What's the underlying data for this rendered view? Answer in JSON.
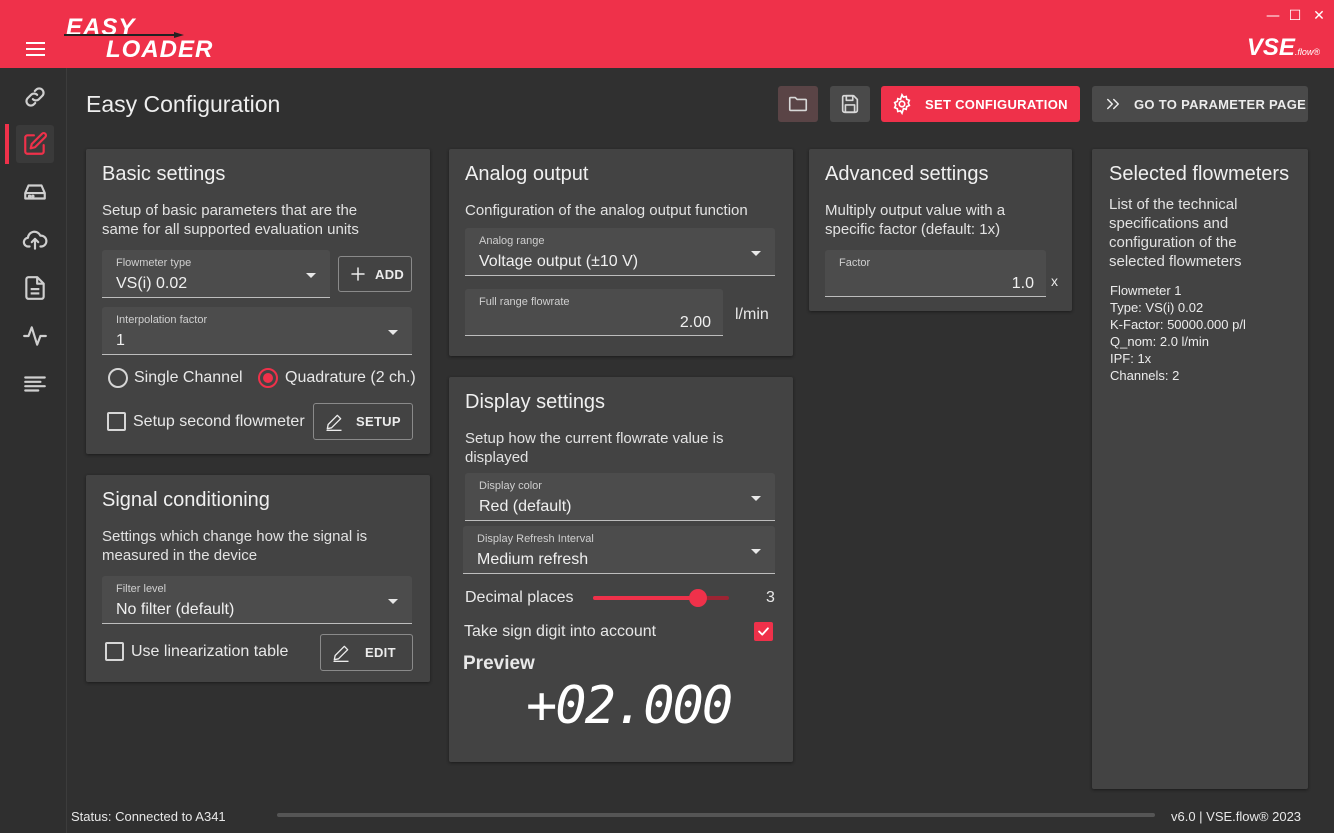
{
  "app": {
    "logo_line1": "EASY",
    "logo_line2": "LOADER",
    "brand": "VSE",
    "brand_sub": ".flow®",
    "window_controls": {
      "minimize": "—",
      "maximize": "☐",
      "close": "✕"
    }
  },
  "sidebar": {
    "items": [
      {
        "icon": "link-icon"
      },
      {
        "icon": "edit-icon",
        "active": true
      },
      {
        "icon": "drive-icon"
      },
      {
        "icon": "cloud-upload-icon"
      },
      {
        "icon": "document-icon"
      },
      {
        "icon": "pulse-icon"
      },
      {
        "icon": "text-lines-icon"
      }
    ]
  },
  "header": {
    "title": "Easy Configuration",
    "set_config_label": "SET CONFIGURATION",
    "goto_param_label": "GO TO PARAMETER PAGE"
  },
  "basic": {
    "title": "Basic settings",
    "desc_line1": "Setup of basic parameters that are the",
    "desc_line2": "same for all supported evaluation units",
    "flowmeter_type_label": "Flowmeter type",
    "flowmeter_type_value": "VS(i) 0.02",
    "add_label": "ADD",
    "interp_label": "Interpolation factor",
    "interp_value": "1",
    "radio_single": "Single Channel",
    "radio_quad": "Quadrature (2 ch.)",
    "second_flowmeter": "Setup second flowmeter",
    "setup_label": "SETUP"
  },
  "signal": {
    "title": "Signal conditioning",
    "desc_line1": "Settings which change how the signal is",
    "desc_line2": "measured in the device",
    "filter_label": "Filter level",
    "filter_value": "No filter (default)",
    "linearization": "Use linearization table",
    "edit_label": "EDIT"
  },
  "analog": {
    "title": "Analog output",
    "desc": "Configuration of the analog output function",
    "range_label": "Analog range",
    "range_value": "Voltage output (±10 V)",
    "flowrate_label": "Full range flowrate",
    "flowrate_value": "2.00",
    "flowrate_unit": "l/min"
  },
  "display": {
    "title": "Display settings",
    "desc_line1": "Setup how the current flowrate value is",
    "desc_line2": "displayed",
    "color_label": "Display color",
    "color_value": "Red (default)",
    "refresh_label": "Display Refresh Interval",
    "refresh_value": "Medium refresh",
    "decimal_label": "Decimal places",
    "decimal_value": "3",
    "decimal_fraction": 0.77,
    "sign_label": "Take sign digit into account",
    "preview_label": "Preview",
    "preview_value": "+02.000"
  },
  "advanced": {
    "title": "Advanced settings",
    "desc_line1": "Multiply output value with a",
    "desc_line2": "specific factor (default: 1x)",
    "factor_label": "Factor",
    "factor_value": "1.0",
    "factor_unit": "x"
  },
  "selected": {
    "title": "Selected flowmeters",
    "desc_line1": "List of the technical",
    "desc_line2": "specifications and",
    "desc_line3": "configuration of the",
    "desc_line4": "selected flowmeters",
    "lines": [
      "Flowmeter 1",
      "Type: VS(i) 0.02",
      "K-Factor: 50000.000 p/l",
      "Q_nom: 2.0 l/min",
      "IPF: 1x",
      "Channels: 2"
    ]
  },
  "status": {
    "text": "Status: Connected to A341",
    "version": "v6.0 | VSE.flow® 2023"
  },
  "colors": {
    "accent": "#ef314a",
    "background": "#303030",
    "card": "#434343"
  }
}
